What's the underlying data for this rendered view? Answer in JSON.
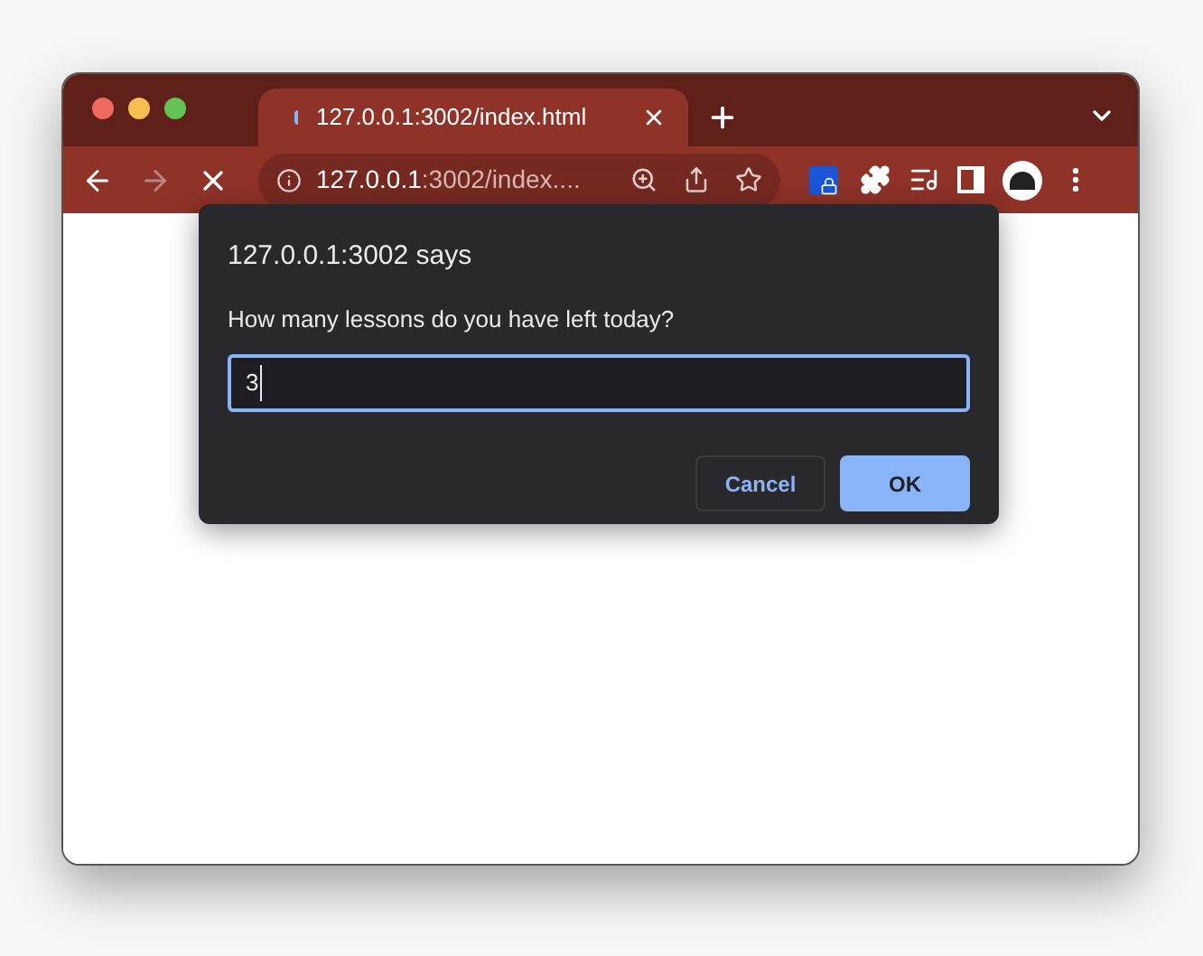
{
  "tabs": [
    {
      "title": "127.0.0.1:3002/index.html",
      "selected": true,
      "loading": true
    }
  ],
  "toolbar": {
    "back_disabled": false,
    "forward_disabled": true
  },
  "address_bar": {
    "host": "127.0.0.1",
    "rest": ":3002/index...."
  },
  "dialog": {
    "title": "127.0.0.1:3002 says",
    "message": "How many lessons do you have left today?",
    "input": {
      "value": "3"
    },
    "buttons": [
      {
        "label": "Cancel",
        "kind": "secondary"
      },
      {
        "label": "OK",
        "kind": "primary"
      }
    ]
  }
}
